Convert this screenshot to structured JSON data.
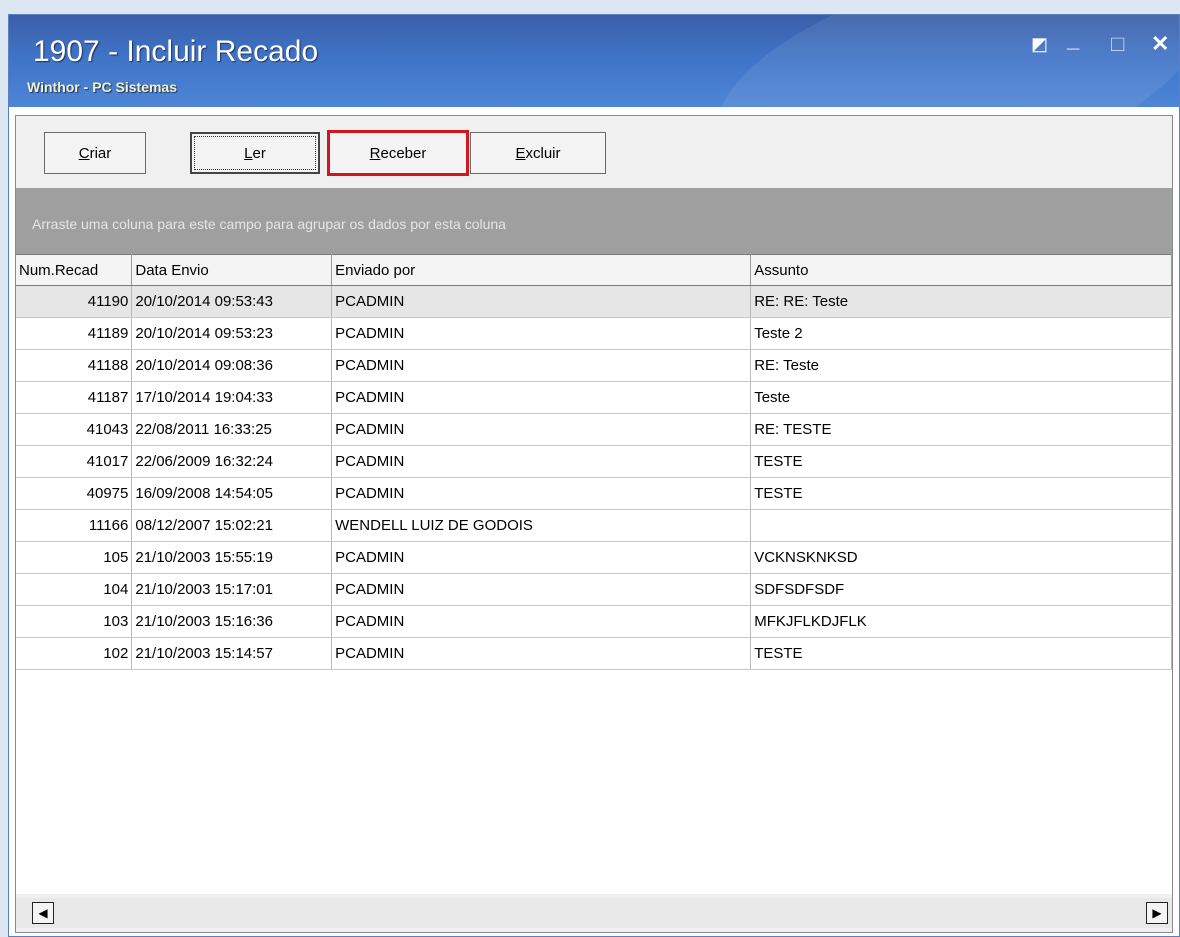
{
  "window": {
    "title": "1907 - Incluir Recado",
    "subtitle": "Winthor - PC Sistemas",
    "controls": {
      "restore": "◩",
      "minimize": "_",
      "maximize": "□",
      "close": "✕"
    }
  },
  "toolbar": {
    "buttons": [
      {
        "first": "C",
        "rest": "riar"
      },
      {
        "first": "L",
        "rest": "er"
      },
      {
        "first": "R",
        "rest": "eceber"
      },
      {
        "first": "E",
        "rest": "xcluir"
      }
    ]
  },
  "group_hint": "Arraste uma coluna para este campo para agrupar os dados por esta coluna",
  "grid": {
    "columns": [
      "Num.Recad",
      "Data Envio",
      "Enviado por",
      "Assunto"
    ],
    "rows": [
      {
        "num": "41190",
        "data": "20/10/2014 09:53:43",
        "from": "PCADMIN",
        "assunto": "RE: RE: Teste"
      },
      {
        "num": "41189",
        "data": "20/10/2014 09:53:23",
        "from": "PCADMIN",
        "assunto": "Teste 2"
      },
      {
        "num": "41188",
        "data": "20/10/2014 09:08:36",
        "from": "PCADMIN",
        "assunto": "RE: Teste"
      },
      {
        "num": "41187",
        "data": "17/10/2014 19:04:33",
        "from": "PCADMIN",
        "assunto": "Teste"
      },
      {
        "num": "41043",
        "data": "22/08/2011 16:33:25",
        "from": "PCADMIN",
        "assunto": "RE: TESTE"
      },
      {
        "num": "41017",
        "data": "22/06/2009 16:32:24",
        "from": "PCADMIN",
        "assunto": "TESTE"
      },
      {
        "num": "40975",
        "data": "16/09/2008 14:54:05",
        "from": "PCADMIN",
        "assunto": "TESTE"
      },
      {
        "num": "11166",
        "data": "08/12/2007 15:02:21",
        "from": "WENDELL LUIZ DE GODOIS",
        "assunto": ""
      },
      {
        "num": "105",
        "data": "21/10/2003 15:55:19",
        "from": "PCADMIN",
        "assunto": "VCKNSKNKSD"
      },
      {
        "num": "104",
        "data": "21/10/2003 15:17:01",
        "from": "PCADMIN",
        "assunto": "SDFSDFSDF"
      },
      {
        "num": "103",
        "data": "21/10/2003 15:16:36",
        "from": "PCADMIN",
        "assunto": "MFKJFLKDJFLK"
      },
      {
        "num": "102",
        "data": "21/10/2003 15:14:57",
        "from": "PCADMIN",
        "assunto": "TESTE"
      }
    ]
  },
  "scrollbar": {
    "left": "◀",
    "right": "▶"
  },
  "colors": {
    "titlebar": "#3f73c6",
    "highlight": "#d1161f",
    "group_band": "#9f9f9f"
  }
}
